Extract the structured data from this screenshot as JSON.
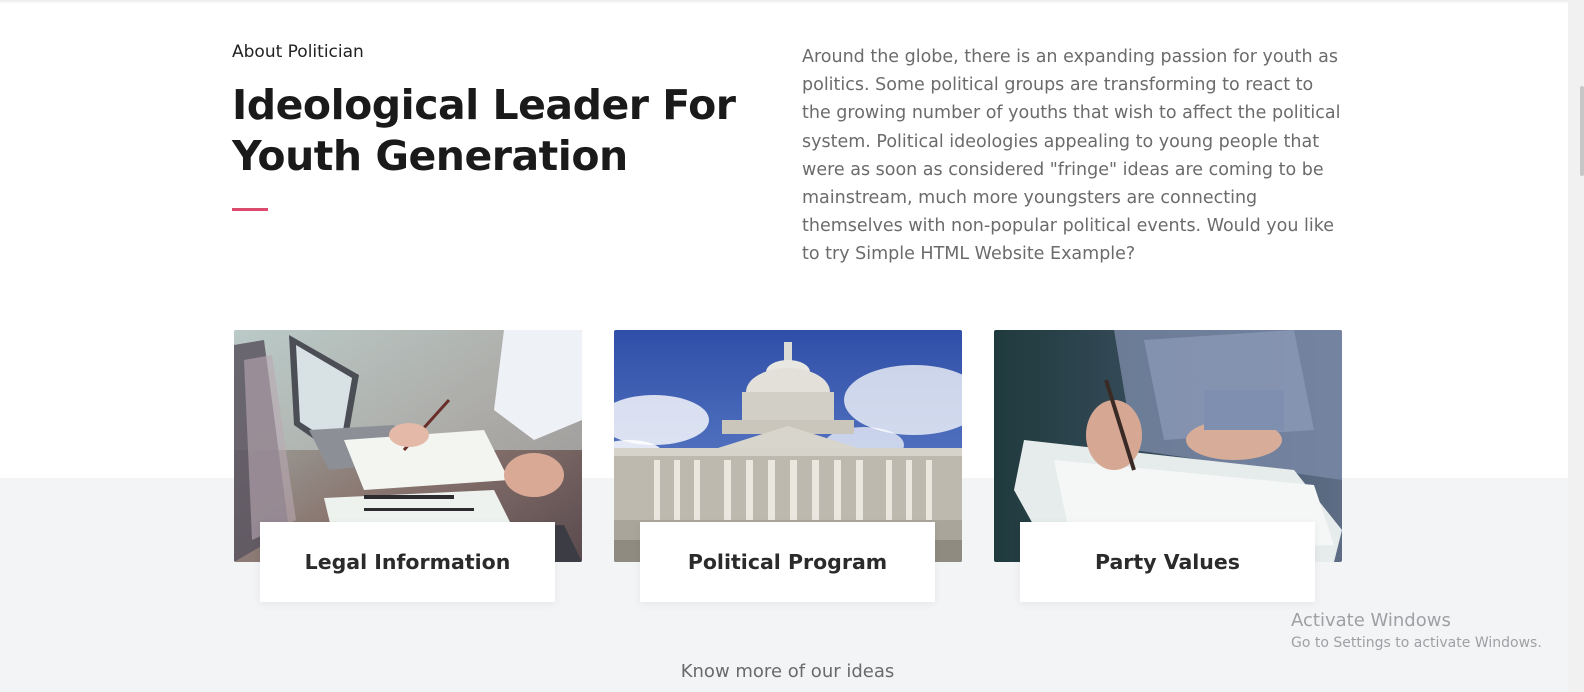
{
  "about": {
    "eyebrow": "About Politician",
    "headline": "Ideological Leader For Youth Generation",
    "intro": "Around the globe, there is an expanding passion for youth as politics. Some political groups are transforming to react to the growing number of youths that wish to affect the political system. Political ideologies appealing to young people that were as soon as considered \"fringe\" ideas are coming to be mainstream, much more youngsters are connecting themselves with non-popular political events. Would you like to try Simple HTML Website Example?"
  },
  "cards": [
    {
      "label": "Legal Information"
    },
    {
      "label": "Political Program"
    },
    {
      "label": "Party Values"
    }
  ],
  "footer": {
    "more": "Know more of our ideas"
  },
  "os_overlay": {
    "title": "Activate Windows",
    "subtitle": "Go to Settings to activate Windows."
  },
  "colors": {
    "accent": "#dc4a6e",
    "section_bg": "#f3f4f6"
  }
}
